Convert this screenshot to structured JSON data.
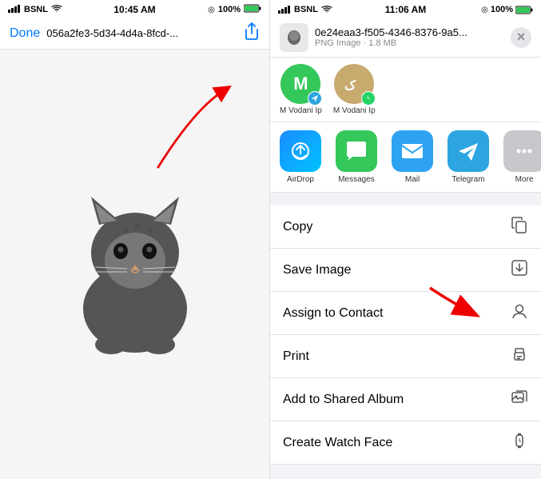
{
  "left": {
    "status": {
      "carrier": "BSNL",
      "time": "10:45 AM",
      "battery": "100%"
    },
    "nav": {
      "done_label": "Done",
      "file_title": "056a2fe3-5d34-4d4a-8fcd-..."
    }
  },
  "right": {
    "status": {
      "carrier": "BSNL",
      "time": "11:06 AM",
      "battery": "100%"
    },
    "file": {
      "name": "0e24eaa3-f505-4346-8376-9a5...",
      "type": "PNG Image",
      "size": "1.8 MB"
    },
    "recipients": [
      {
        "initials": "M",
        "label": "M Vodani Ip",
        "badge": "telegram",
        "color": "green"
      },
      {
        "initials": "",
        "label": "M Vodani Ip",
        "badge": "whatsapp",
        "color": "beige"
      }
    ],
    "apps": [
      {
        "name": "AirDrop",
        "type": "airdrop"
      },
      {
        "name": "Messages",
        "type": "messages"
      },
      {
        "name": "Mail",
        "type": "mail"
      },
      {
        "name": "Telegram",
        "type": "telegram"
      }
    ],
    "actions": [
      {
        "label": "Copy",
        "icon": "copy"
      },
      {
        "label": "Save Image",
        "icon": "save"
      },
      {
        "label": "Assign to Contact",
        "icon": "contact"
      },
      {
        "label": "Print",
        "icon": "print"
      },
      {
        "label": "Add to Shared Album",
        "icon": "album"
      },
      {
        "label": "Create Watch Face",
        "icon": "watch"
      }
    ]
  }
}
